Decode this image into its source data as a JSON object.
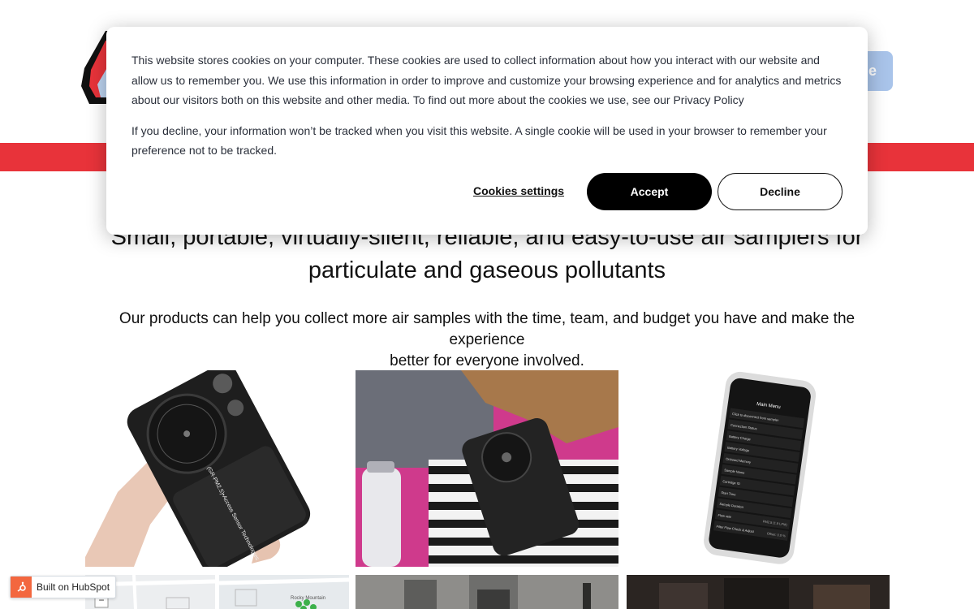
{
  "header": {
    "cta_label": "e"
  },
  "hero": {
    "title_line1": "Small, portable, virtually-silent, reliable, and easy-to-use air samplers for",
    "title_line2": "particulate and gaseous pollutants",
    "subtitle_line1": "Our products can help you collect more air samples with the time, team, and budget you have and make the experience",
    "subtitle_line2": "better for everyone involved."
  },
  "products": {
    "device_engraving": "(GR-PM2.5)•Access Sensor Technologies",
    "phone_title": "Main Menu",
    "phone_rows": [
      "Click to disconnect from sampler",
      "Connection Status",
      "Battery Charge",
      "Battery Voltage",
      "Onboard Memory",
      "Sample Name",
      "Cartridge ID",
      "Start Time",
      "Sample Duration",
      "Flow rate",
      "Filter Flow Check & Adjust"
    ],
    "phone_values": [
      "",
      "",
      "",
      "",
      "",
      "",
      "",
      "",
      "",
      "PM2.5 (1.9 LPM)",
      "Offset: 0.0 %"
    ],
    "map_label": "Rocky Mountain"
  },
  "hubspot": {
    "label": "Built on HubSpot"
  },
  "cookie": {
    "paragraph1": "This website stores cookies on your computer. These cookies are used to collect information about how you interact with our website and allow us to remember you. We use this information in order to improve and customize your browsing experience and for analytics and metrics about our visitors both on this website and other media. To find out more about the cookies we use, see our Privacy Policy",
    "paragraph2": "If you decline, your information won’t be tracked when you visit this website. A single cookie will be used in your browser to remember your preference not to be tracked.",
    "settings_label": "Cookies settings",
    "accept_label": "Accept",
    "decline_label": "Decline"
  },
  "colors": {
    "brand_red": "#e8333a",
    "cta_blue": "#a9c4ea",
    "accept_bg": "#000000",
    "hubspot_orange": "#f3673f"
  }
}
